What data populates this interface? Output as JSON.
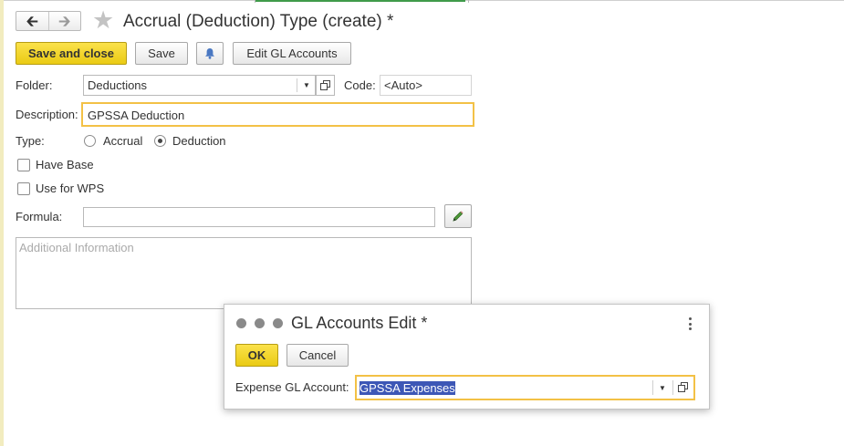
{
  "window": {
    "title": "Accrual (Deduction) Type (create) *"
  },
  "toolbar": {
    "save_close_label": "Save and close",
    "save_label": "Save",
    "edit_gl_label": "Edit GL Accounts"
  },
  "form": {
    "folder_label": "Folder:",
    "folder_value": "Deductions",
    "code_label": "Code:",
    "code_placeholder": "<Auto>",
    "description_label": "Description:",
    "description_value": "GPSSA Deduction",
    "type_label": "Type:",
    "type_options": [
      "Accrual",
      "Deduction"
    ],
    "type_selected": "Deduction",
    "have_base_label": "Have Base",
    "have_base_checked": false,
    "use_wps_label": "Use for WPS",
    "use_wps_checked": false,
    "formula_label": "Formula:",
    "formula_value": "",
    "additional_info_placeholder": "Additional Information"
  },
  "dialog": {
    "title": "GL Accounts Edit *",
    "ok_label": "OK",
    "cancel_label": "Cancel",
    "expense_label": "Expense GL Account:",
    "expense_value": "GPSSA Expenses"
  },
  "colors": {
    "primary_button": "#f0d11e",
    "focus_border": "#f3c146",
    "selection": "#3d57b6",
    "active_tab": "#3f9b4a"
  },
  "icons": {
    "back": "arrow-left-icon",
    "forward": "arrow-right-icon",
    "favorite": "star-icon",
    "notify": "bell-icon",
    "formula_edit": "pencil-icon",
    "open": "open-window-icon",
    "dropdown": "chevron-down-icon",
    "menu": "kebab-menu-icon"
  }
}
